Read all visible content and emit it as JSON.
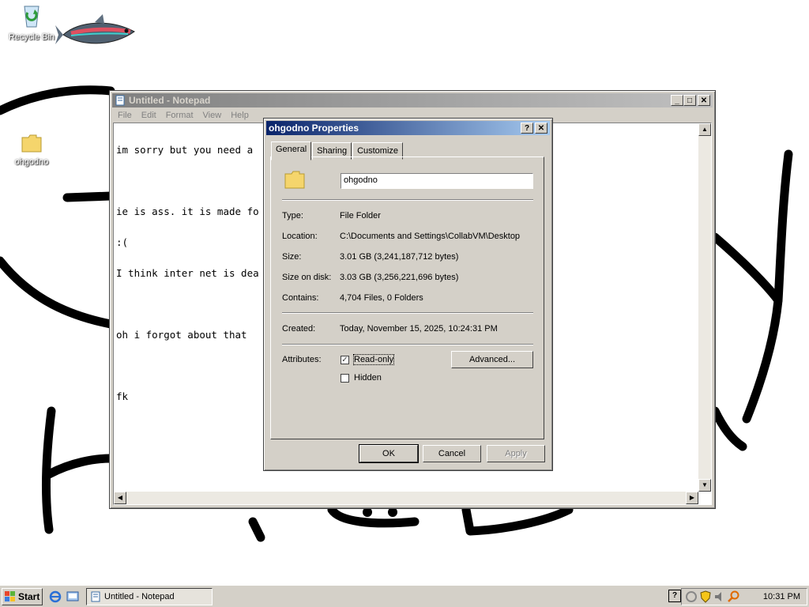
{
  "desktop": {
    "icons": [
      {
        "label": "Recycle Bin"
      },
      {
        "label": "ohgodno"
      }
    ]
  },
  "notepad": {
    "title": "Untitled - Notepad",
    "menu": [
      "File",
      "Edit",
      "Format",
      "View",
      "Help"
    ],
    "lines": [
      "im sorry but you need a",
      "",
      "ie is ass. it is made fo",
      ":(",
      "I think inter net is dea",
      "",
      "oh i forgot about that ",
      "",
      "fk"
    ]
  },
  "properties": {
    "title": "ohgodno Properties",
    "tabs": [
      "General",
      "Sharing",
      "Customize"
    ],
    "name": "ohgodno",
    "type_label": "Type:",
    "type_value": "File Folder",
    "location_label": "Location:",
    "location_value": "C:\\Documents and Settings\\CollabVM\\Desktop",
    "size_label": "Size:",
    "size_value": "3.01 GB (3,241,187,712 bytes)",
    "size_on_disk_label": "Size on disk:",
    "size_on_disk_value": "3.03 GB (3,256,221,696 bytes)",
    "contains_label": "Contains:",
    "contains_value": "4,704 Files, 0 Folders",
    "created_label": "Created:",
    "created_value": "Today, November 15, 2025, 10:24:31 PM",
    "attributes_label": "Attributes:",
    "readonly_label": "Read-only",
    "readonly_checked": true,
    "hidden_label": "Hidden",
    "hidden_checked": false,
    "advanced_label": "Advanced...",
    "ok_label": "OK",
    "cancel_label": "Cancel",
    "apply_label": "Apply"
  },
  "taskbar": {
    "start_label": "Start",
    "task_label": "Untitled - Notepad",
    "clock": "10:31 PM"
  }
}
